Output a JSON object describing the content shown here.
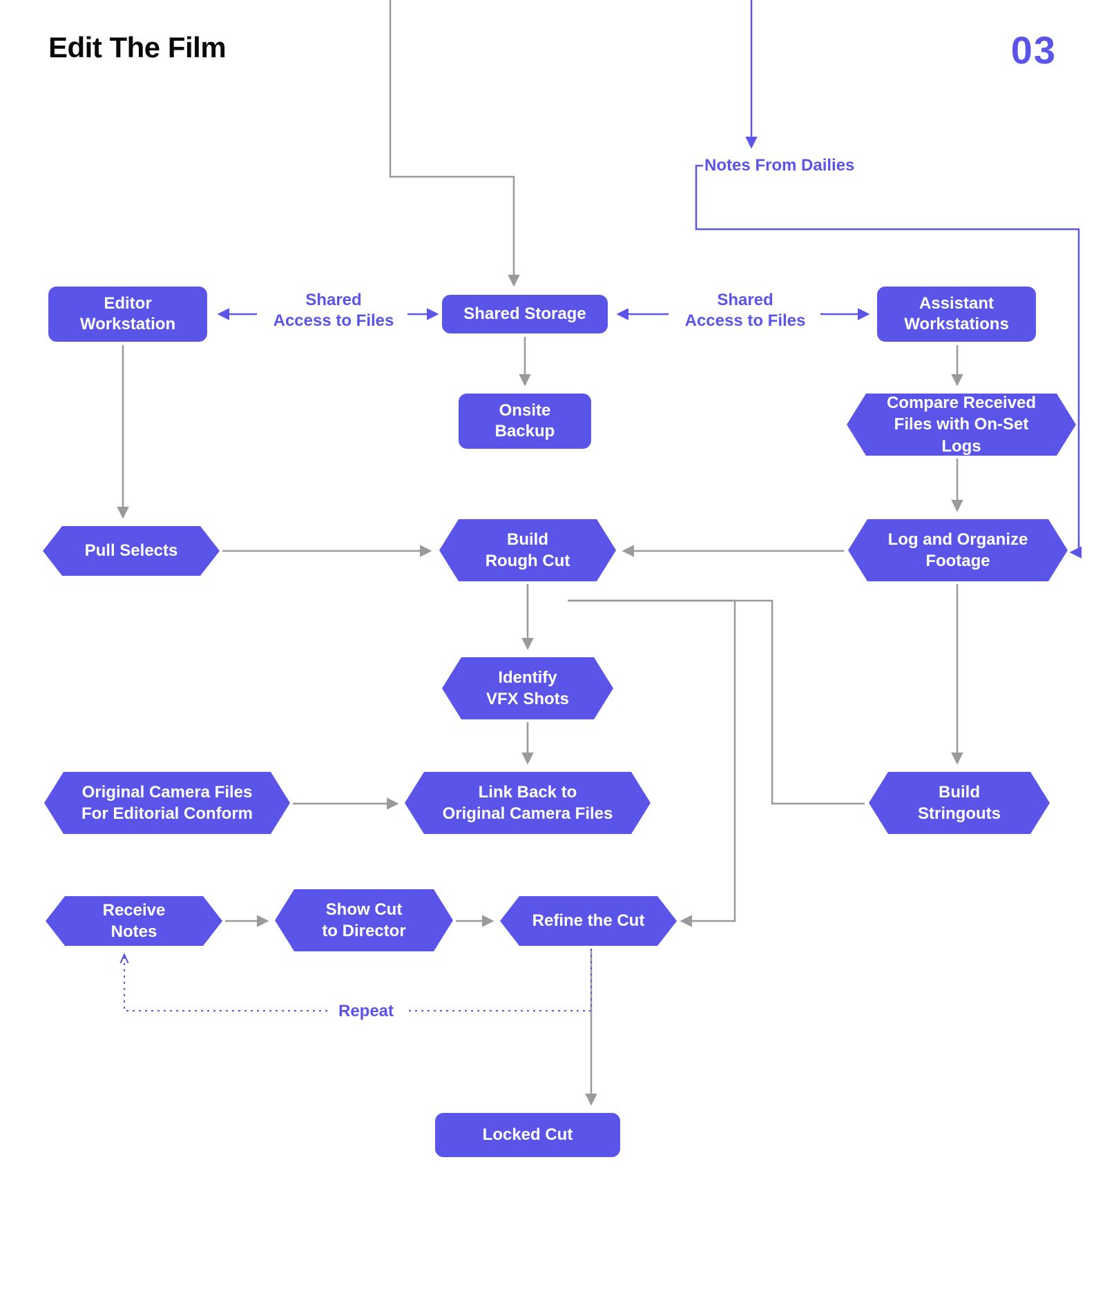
{
  "header": {
    "title": "Edit The Film",
    "step_number": "03"
  },
  "labels": {
    "notes_from_dailies": "Notes From Dailies",
    "shared_access_left": "Shared\nAccess to Files",
    "shared_access_right": "Shared\nAccess to Files",
    "repeat": "Repeat"
  },
  "nodes": {
    "editor_workstation": "Editor\nWorkstation",
    "shared_storage": "Shared Storage",
    "assistant_workstations": "Assistant\nWorkstations",
    "onsite_backup": "Onsite\nBackup",
    "compare_received": "Compare Received\nFiles with On-Set Logs",
    "pull_selects": "Pull Selects",
    "build_rough_cut": "Build\nRough Cut",
    "log_and_organize": "Log and Organize\nFootage",
    "identify_vfx": "Identify\nVFX Shots",
    "original_camera": "Original Camera Files\nFor Editorial Conform",
    "link_back": "Link Back to\nOriginal Camera Files",
    "build_stringouts": "Build\nStringouts",
    "receive_notes": "Receive Notes",
    "show_cut": "Show Cut\nto Director",
    "refine_cut": "Refine the Cut",
    "locked_cut": "Locked Cut"
  }
}
